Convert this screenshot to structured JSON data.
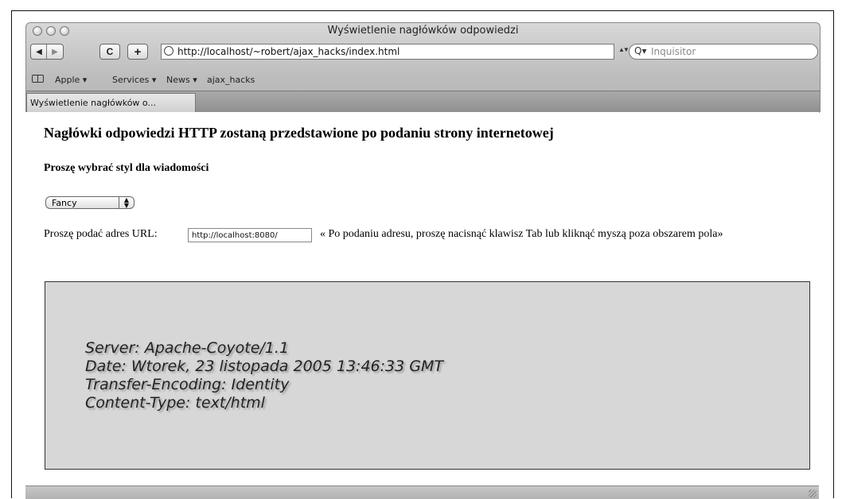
{
  "window": {
    "title": "Wyświetlenie nagłówków odpowiedzi"
  },
  "toolbar": {
    "back_glyph": "◀",
    "forward_glyph": "▶",
    "reload_glyph": "C",
    "add_glyph": "+",
    "url": "http://localhost/~robert/ajax_hacks/index.html",
    "url_dropdown_glyph": "▲▼",
    "search_placeholder": "Inquisitor",
    "search_icon_glyph": "Q▾"
  },
  "bookmarks": {
    "items": [
      "Apple ▾",
      "Services ▾",
      "News ▾",
      "ajax_hacks"
    ]
  },
  "tabs": [
    "Wyświetlenie nagłówków o..."
  ],
  "page": {
    "heading": "Nagłówki odpowiedzi HTTP zostaną przedstawione po podaniu strony internetowej",
    "subheading": "Proszę wybrać styl dla wiadomości",
    "style_select": {
      "value": "Fancy"
    },
    "url_label": "Proszę podać adres URL:",
    "url_input_value": "http://localhost:8080/",
    "hint": "« Po podaniu adresu, proszę nacisnąć klawisz Tab lub kliknąć myszą poza obszarem pola»",
    "response_headers": [
      "Server: Apache-Coyote/1.1",
      "Date: Wtorek, 23 listopada 2005 13:46:33 GMT",
      "Transfer-Encoding: Identity",
      "Content-Type: text/html"
    ]
  }
}
